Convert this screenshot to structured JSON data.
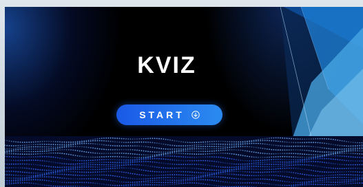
{
  "slide": {
    "title": "KVIZ",
    "start_button": {
      "label": "START",
      "icon": "arrow-down-circle-icon"
    }
  },
  "colors": {
    "background": "#000000",
    "accent": "#2b8bf0",
    "title": "#ffffff"
  }
}
